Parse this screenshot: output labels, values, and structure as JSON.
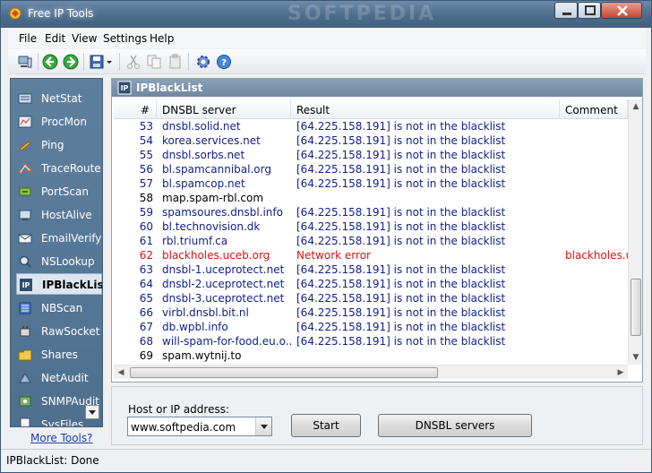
{
  "window": {
    "title": "Free IP Tools",
    "watermark": "SOFTPEDIA"
  },
  "menu": [
    "File",
    "Edit",
    "View",
    "Settings",
    "Help"
  ],
  "toolbar_icons": [
    "computer-icon",
    "back-icon",
    "forward-icon",
    "save-icon",
    "cut-icon",
    "copy-icon",
    "paste-icon",
    "settings-icon",
    "help-icon"
  ],
  "sidebar": {
    "items": [
      {
        "label": "NetStat",
        "icon": "netstat-icon"
      },
      {
        "label": "ProcMon",
        "icon": "procmon-icon"
      },
      {
        "label": "Ping",
        "icon": "ping-icon"
      },
      {
        "label": "TraceRoute",
        "icon": "traceroute-icon"
      },
      {
        "label": "PortScan",
        "icon": "portscan-icon"
      },
      {
        "label": "HostAlive",
        "icon": "hostalive-icon"
      },
      {
        "label": "EmailVerify",
        "icon": "emailverify-icon"
      },
      {
        "label": "NSLookup",
        "icon": "nslookup-icon"
      },
      {
        "label": "IPBlackList",
        "icon": "ipblacklist-icon"
      },
      {
        "label": "NBScan",
        "icon": "nbscan-icon"
      },
      {
        "label": "RawSocket",
        "icon": "rawsocket-icon"
      },
      {
        "label": "Shares",
        "icon": "shares-icon"
      },
      {
        "label": "NetAudit",
        "icon": "netaudit-icon"
      },
      {
        "label": "SNMPAudit",
        "icon": "snmpaudit-icon"
      },
      {
        "label": "SysFiles",
        "icon": "sysfiles-icon"
      }
    ],
    "active": "IPBlackList",
    "more_tools": "More Tools?"
  },
  "panel": {
    "title": "IPBlackList",
    "columns": [
      "#",
      "DNSBL server",
      "Result",
      "Comment"
    ],
    "rows": [
      {
        "num": "53",
        "server": "dnsbl.solid.net",
        "result": "[64.225.158.191] is not in the blacklist",
        "comment": "",
        "status": "ok"
      },
      {
        "num": "54",
        "server": "korea.services.net",
        "result": "[64.225.158.191] is not in the blacklist",
        "comment": "",
        "status": "ok"
      },
      {
        "num": "55",
        "server": "dnsbl.sorbs.net",
        "result": "[64.225.158.191] is not in the blacklist",
        "comment": "",
        "status": "ok"
      },
      {
        "num": "56",
        "server": "bl.spamcannibal.org",
        "result": "[64.225.158.191] is not in the blacklist",
        "comment": "",
        "status": "ok"
      },
      {
        "num": "57",
        "server": "bl.spamcop.net",
        "result": "[64.225.158.191] is not in the blacklist",
        "comment": "",
        "status": "ok"
      },
      {
        "num": "58",
        "server": "map.spam-rbl.com",
        "result": "",
        "comment": "",
        "status": "pending"
      },
      {
        "num": "59",
        "server": "spamsoures.dnsbl.info",
        "result": "[64.225.158.191] is not in the blacklist",
        "comment": "",
        "status": "ok"
      },
      {
        "num": "60",
        "server": "bl.technovision.dk",
        "result": "[64.225.158.191] is not in the blacklist",
        "comment": "",
        "status": "ok"
      },
      {
        "num": "61",
        "server": "rbl.triumf.ca",
        "result": "[64.225.158.191] is not in the blacklist",
        "comment": "",
        "status": "ok"
      },
      {
        "num": "62",
        "server": "blackholes.uceb.org",
        "result": "Network error",
        "comment": "blackholes.uc",
        "status": "error"
      },
      {
        "num": "63",
        "server": "dnsbl-1.uceprotect.net",
        "result": "[64.225.158.191] is not in the blacklist",
        "comment": "",
        "status": "ok"
      },
      {
        "num": "64",
        "server": "dnsbl-2.uceprotect.net",
        "result": "[64.225.158.191] is not in the blacklist",
        "comment": "",
        "status": "ok"
      },
      {
        "num": "65",
        "server": "dnsbl-3.uceprotect.net",
        "result": "[64.225.158.191] is not in the blacklist",
        "comment": "",
        "status": "ok"
      },
      {
        "num": "66",
        "server": "virbl.dnsbl.bit.nl",
        "result": "[64.225.158.191] is not in the blacklist",
        "comment": "",
        "status": "ok"
      },
      {
        "num": "67",
        "server": "db.wpbl.info",
        "result": "[64.225.158.191] is not in the blacklist",
        "comment": "",
        "status": "ok"
      },
      {
        "num": "68",
        "server": "will-spam-for-food.eu.o...",
        "result": "[64.225.158.191] is not in the blacklist",
        "comment": "",
        "status": "ok"
      },
      {
        "num": "69",
        "server": "spam.wytnij.to",
        "result": "",
        "comment": "",
        "status": "pending"
      }
    ]
  },
  "form": {
    "host_label": "Host or IP address:",
    "host_value": "www.softpedia.com",
    "start_label": "Start",
    "dnsbl_label": "DNSBL servers"
  },
  "status": "IPBlackList: Done",
  "colors": {
    "ok_text": "#13218c",
    "error_text": "#e01010",
    "sidebar_bg": "#5f7f9f",
    "titlebar_bg": "#4d6c8c"
  }
}
